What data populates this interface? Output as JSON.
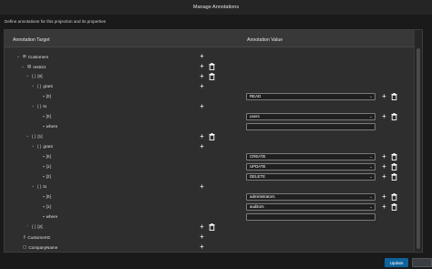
{
  "dialog": {
    "title": "Manage Annotations",
    "subtitle": "Define annotations for this projection and its properties"
  },
  "headers": {
    "target": "Annotation Target",
    "value": "Annotation Value"
  },
  "rows": [
    {
      "label": "Customers",
      "icon": "table-icon",
      "glyph": "⊞",
      "chev": "⌄",
      "add": true,
      "del": false
    },
    {
      "label": "restrict",
      "icon": "annotation-icon",
      "glyph": "▤",
      "chev": "⌄",
      "add": true,
      "del": true
    },
    {
      "label": "[0]",
      "icon": "array-icon",
      "glyph": "{ }",
      "chev": "⌄",
      "add": true,
      "del": true
    },
    {
      "label": "grant",
      "icon": "object-icon",
      "glyph": "{ }",
      "chev": "⌄",
      "add": true,
      "del": false
    },
    {
      "label": "[0]",
      "icon": "value-icon",
      "glyph": "▪",
      "chev": "",
      "add": true,
      "del": true,
      "select": "READ"
    },
    {
      "label": "to",
      "icon": "object-icon",
      "glyph": "{ }",
      "chev": "⌄",
      "add": true,
      "del": false
    },
    {
      "label": "[0]",
      "icon": "value-icon",
      "glyph": "▪",
      "chev": "",
      "add": true,
      "del": true,
      "select": "users"
    },
    {
      "label": "where",
      "icon": "value-icon",
      "glyph": "▪",
      "chev": "",
      "add": false,
      "del": false,
      "text": ""
    },
    {
      "label": "[1]",
      "icon": "array-icon",
      "glyph": "{ }",
      "chev": "⌄",
      "add": true,
      "del": true
    },
    {
      "label": "grant",
      "icon": "object-icon",
      "glyph": "{ }",
      "chev": "⌄",
      "add": true,
      "del": false
    },
    {
      "label": "[0]",
      "icon": "value-icon",
      "glyph": "▪",
      "chev": "",
      "add": true,
      "del": true,
      "select": "CREATE"
    },
    {
      "label": "[1]",
      "icon": "value-icon",
      "glyph": "▪",
      "chev": "",
      "add": true,
      "del": true,
      "select": "UPDATE"
    },
    {
      "label": "[2]",
      "icon": "value-icon",
      "glyph": "▪",
      "chev": "",
      "add": true,
      "del": true,
      "select": "DELETE"
    },
    {
      "label": "to",
      "icon": "object-icon",
      "glyph": "{ }",
      "chev": "⌄",
      "add": true,
      "del": false
    },
    {
      "label": "[0]",
      "icon": "value-icon",
      "glyph": "▪",
      "chev": "",
      "add": true,
      "del": true,
      "select": "administrators"
    },
    {
      "label": "[1]",
      "icon": "value-icon",
      "glyph": "▪",
      "chev": "",
      "add": true,
      "del": true,
      "select": "auditors"
    },
    {
      "label": "where",
      "icon": "value-icon",
      "glyph": "▪",
      "chev": "",
      "add": false,
      "del": false,
      "text": ""
    },
    {
      "label": "[2]",
      "icon": "array-icon",
      "glyph": "{ }",
      "chev": "›",
      "add": true,
      "del": true
    },
    {
      "label": "CustomerID",
      "icon": "key-icon",
      "glyph": "⚷",
      "chev": "",
      "add": true,
      "del": false
    },
    {
      "label": "CompanyName",
      "icon": "field-icon",
      "glyph": "▢",
      "chev": "",
      "add": true,
      "del": false
    }
  ],
  "footer": {
    "update_label": "Update",
    "cancel_label": ""
  },
  "colors": {
    "accent": "#0e639c",
    "panel": "#2e2e2e",
    "background": "#1a1a1a"
  }
}
